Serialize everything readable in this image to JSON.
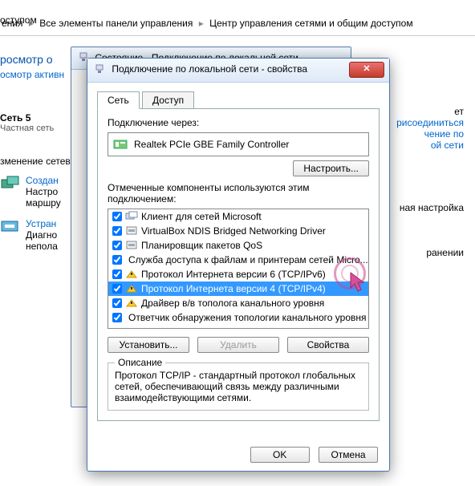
{
  "bg": {
    "truncated_title": "оступом",
    "breadcrumb": {
      "item1": "ения",
      "item2": "Все элементы панели управления",
      "item3": "Центр управления сетями и общим доступом"
    },
    "left_blue": "росмотр о",
    "left_task": "осмотр активн",
    "net_name": "Сеть 5",
    "net_type": "Частная сеть",
    "section1": "зменение сетев",
    "link1": "Создан",
    "desc1a": "Настро",
    "desc1b": "маршру",
    "link2": "Устран",
    "desc2a": "Диагно",
    "desc2b": "непола",
    "right1": "рисоединиться",
    "right2": "чение по",
    "right3": "ой сети",
    "right4": "ная настройка",
    "right5": "ет",
    "right6": "ранении"
  },
  "dlg_behind": {
    "title": "Состояние - Подключение по локальной сети"
  },
  "dlg": {
    "title": "Подключение по локальной сети - свойства",
    "tabs": {
      "net": "Сеть",
      "access": "Доступ"
    },
    "connect_via": "Подключение через:",
    "adapter": "Realtek PCIe GBE Family Controller",
    "configure": "Настроить...",
    "components_lbl": "Отмеченные компоненты используются этим подключением:",
    "items": [
      "Клиент для сетей Microsoft",
      "VirtualBox NDIS Bridged Networking Driver",
      "Планировщик пакетов QoS",
      "Служба доступа к файлам и принтерам сетей Micro...",
      "Протокол Интернета версии 6 (TCP/IPv6)",
      "Протокол Интернета версии 4 (TCP/IPv4)",
      "Драйвер в/в тополога канального уровня",
      "Ответчик обнаружения топологии канального уровня"
    ],
    "install": "Установить...",
    "remove": "Удалить",
    "properties": "Свойства",
    "desc_legend": "Описание",
    "desc_text": "Протокол TCP/IP - стандартный протокол глобальных сетей, обеспечивающий связь между различными взаимодействующими сетями.",
    "ok": "OK",
    "cancel": "Отмена"
  }
}
